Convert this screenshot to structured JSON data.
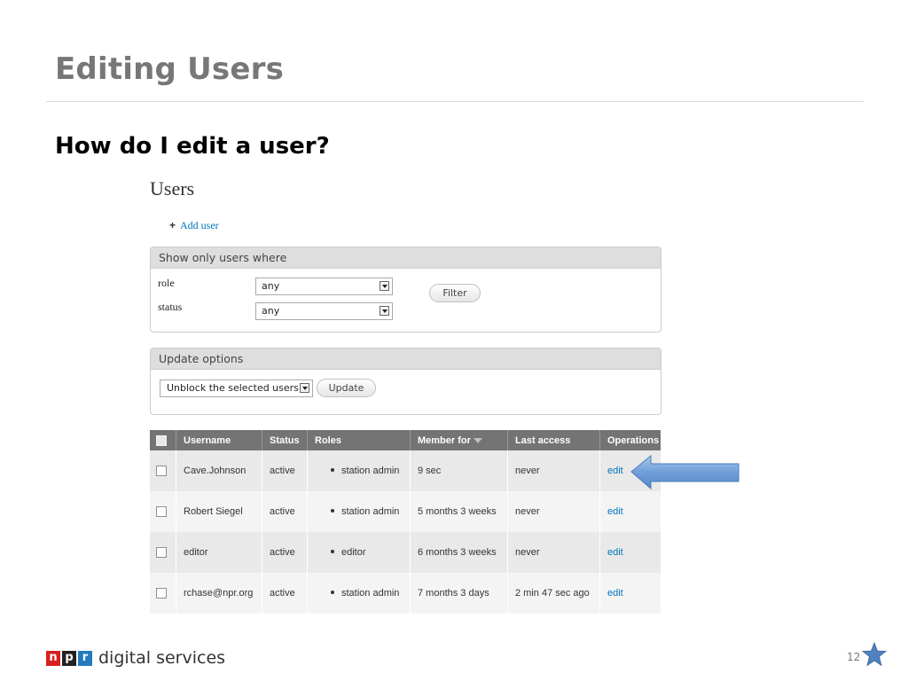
{
  "slide": {
    "title": "Editing Users",
    "subtitle": "How do I edit a user?",
    "page_number": "12"
  },
  "screen": {
    "heading": "Users",
    "add_user": "Add user",
    "filter": {
      "legend": "Show only users where",
      "role_label": "role",
      "role_value": "any",
      "status_label": "status",
      "status_value": "any",
      "button": "Filter"
    },
    "update": {
      "legend": "Update options",
      "action_value": "Unblock the selected users",
      "button": "Update"
    },
    "table": {
      "headers": [
        "Username",
        "Status",
        "Roles",
        "Member for",
        "Last access",
        "Operations"
      ],
      "rows": [
        {
          "username": "Cave.Johnson",
          "status": "active",
          "role": "station admin",
          "member_for": "9 sec",
          "last_access": "never",
          "operation": "edit"
        },
        {
          "username": "Robert Siegel",
          "status": "active",
          "role": "station admin",
          "member_for": "5 months 3 weeks",
          "last_access": "never",
          "operation": "edit"
        },
        {
          "username": "editor",
          "status": "active",
          "role": "editor",
          "member_for": "6 months 3 weeks",
          "last_access": "never",
          "operation": "edit"
        },
        {
          "username": "rchase@npr.org",
          "status": "active",
          "role": "station admin",
          "member_for": "7 months 3 days",
          "last_access": "2 min 47 sec ago",
          "operation": "edit"
        }
      ]
    }
  },
  "footer": {
    "logo_letters": [
      "n",
      "p",
      "r"
    ],
    "logo_colors": [
      "#d62021",
      "#222222",
      "#237bbd"
    ],
    "text": "digital services"
  },
  "colors": {
    "title_gray": "#777777",
    "link_blue": "#0074bd",
    "table_header": "#747474",
    "arrow_blue": "#6f9fd8",
    "star_blue": "#4f81bd"
  },
  "icons": {
    "add": "plus-icon",
    "callout": "left-arrow-icon",
    "corner": "star-icon"
  }
}
